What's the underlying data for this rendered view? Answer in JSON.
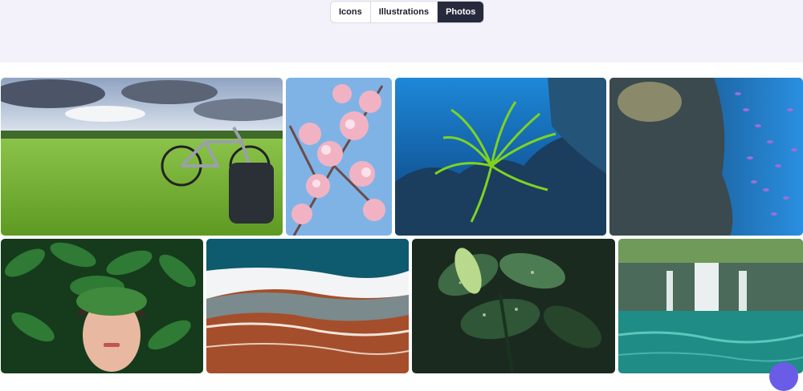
{
  "tabs": [
    {
      "label": "Icons",
      "active": false
    },
    {
      "label": "Illustrations",
      "active": false
    },
    {
      "label": "Photos",
      "active": true
    }
  ],
  "photos": [
    {
      "subject": "bicycle on green meadow under cloudy sky"
    },
    {
      "subject": "pink cherry blossoms against blue sky"
    },
    {
      "subject": "underwater coral with green feather star"
    },
    {
      "subject": "reef rock with school of purple fish"
    },
    {
      "subject": "woman face behind green leaves"
    },
    {
      "subject": "aerial ocean waves on red sand beach"
    },
    {
      "subject": "dark green leaves with water drops"
    },
    {
      "subject": "waterfall in forest with turquoise lake"
    }
  ],
  "colors": {
    "header_bg": "#f3f2fb",
    "active_tab_bg": "#272a3d",
    "fab": "#6b5ce7"
  }
}
